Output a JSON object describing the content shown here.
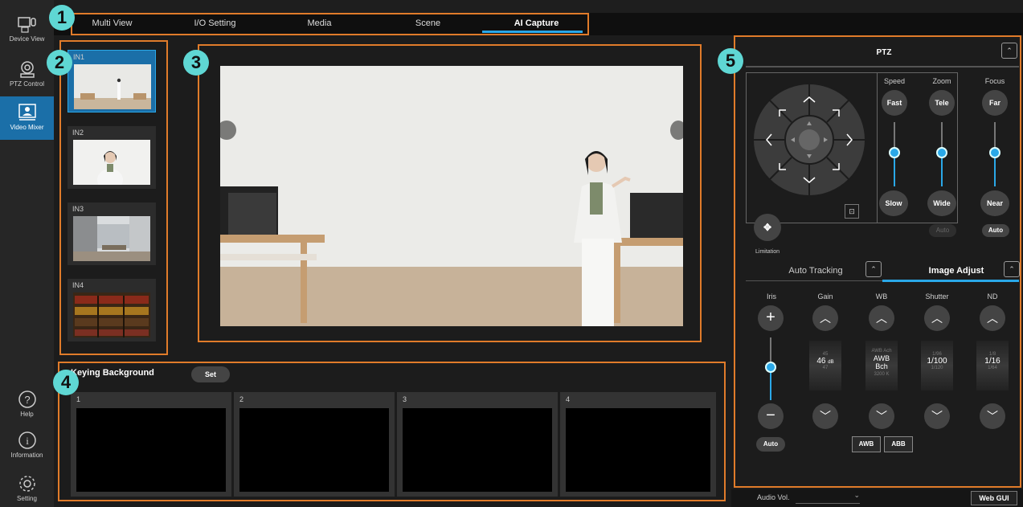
{
  "sidebar": {
    "items": [
      {
        "label": "Device View",
        "icon": "device-view-icon"
      },
      {
        "label": "PTZ Control",
        "icon": "ptz-camera-icon"
      },
      {
        "label": "Video Mixer",
        "icon": "video-mixer-icon",
        "active": true
      }
    ],
    "bottom": [
      {
        "label": "Help",
        "icon": "help-icon"
      },
      {
        "label": "Information",
        "icon": "information-icon"
      },
      {
        "label": "Setting",
        "icon": "gear-icon"
      }
    ]
  },
  "tabs": [
    {
      "label": "Multi View"
    },
    {
      "label": "I/O Setting"
    },
    {
      "label": "Media"
    },
    {
      "label": "Scene"
    },
    {
      "label": "AI Capture",
      "active": true
    }
  ],
  "callouts": [
    "1",
    "2",
    "3",
    "4",
    "5"
  ],
  "inputs": [
    {
      "label": "IN1",
      "selected": true
    },
    {
      "label": "IN2"
    },
    {
      "label": "IN3"
    },
    {
      "label": "IN4"
    }
  ],
  "keying": {
    "title": "Keying Background",
    "set_label": "Set",
    "slots": [
      "1",
      "2",
      "3",
      "4"
    ]
  },
  "ptz": {
    "title": "PTZ",
    "speed_label": "Speed",
    "zoom_label": "Zoom",
    "focus_label": "Focus",
    "fast_label": "Fast",
    "slow_label": "Slow",
    "tele_label": "Tele",
    "wide_label": "Wide",
    "far_label": "Far",
    "near_label": "Near",
    "zoom_auto_label": "Auto",
    "focus_auto_label": "Auto",
    "limitation_label": "Limitation"
  },
  "adjust": {
    "auto_tracking_label": "Auto Tracking",
    "image_adjust_label": "Image Adjust",
    "columns": {
      "iris": "Iris",
      "gain": "Gain",
      "wb": "WB",
      "shutter": "Shutter",
      "nd": "ND"
    },
    "gain_value": "46",
    "gain_unit": "dB",
    "gain_prev": "45",
    "gain_next": "47",
    "wb_value_1": "AWB",
    "wb_value_2": "Bch",
    "wb_prev": "AWB Ach",
    "wb_next": "3200 K",
    "shutter_value": "1/100",
    "shutter_prev": "1/96",
    "shutter_next": "1/120",
    "nd_value": "1/16",
    "nd_prev": "1/8",
    "nd_next": "1/64",
    "iris_auto_label": "Auto",
    "awb_label": "AWB",
    "abb_label": "ABB"
  },
  "footer": {
    "audio_label": "Audio Vol.",
    "webgui_label": "Web GUI"
  },
  "colors": {
    "accent": "#2aa8e8",
    "highlight_border": "#e07b2a",
    "callout": "#5fd7d4"
  }
}
